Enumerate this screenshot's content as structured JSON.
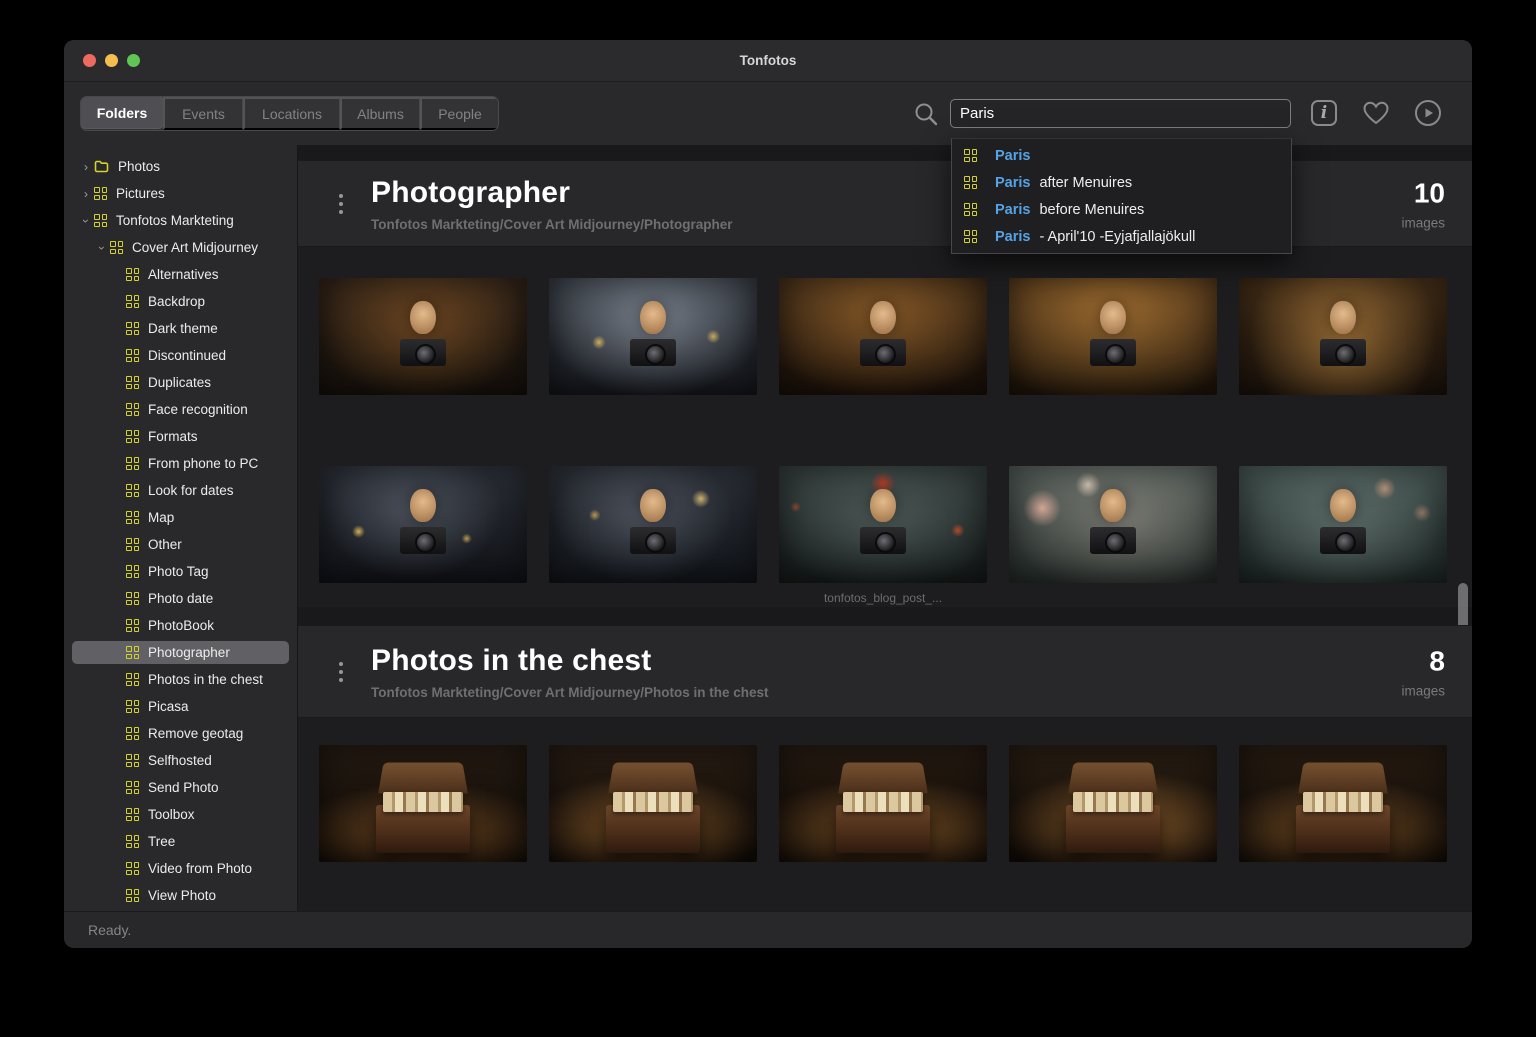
{
  "window": {
    "title": "Tonfotos"
  },
  "toolbar": {
    "tabs": [
      {
        "label": "Folders",
        "active": true
      },
      {
        "label": "Events",
        "active": false
      },
      {
        "label": "Locations",
        "active": false
      },
      {
        "label": "Albums",
        "active": false
      },
      {
        "label": "People",
        "active": false
      }
    ],
    "search": {
      "value": "Paris"
    },
    "icons": [
      "search-icon",
      "info-icon",
      "heart-icon",
      "play-icon"
    ]
  },
  "search_suggestions": [
    {
      "highlight": "Paris",
      "rest": ""
    },
    {
      "highlight": "Paris",
      "rest": " after Menuires"
    },
    {
      "highlight": "Paris",
      "rest": " before Menuires"
    },
    {
      "highlight": "Paris",
      "rest": " - April'10 -Eyjafjallajökull"
    }
  ],
  "sidebar": {
    "items": [
      {
        "label": "Photos",
        "level": 0,
        "icon": "folder",
        "chevron": "collapsed",
        "selected": false
      },
      {
        "label": "Pictures",
        "level": 0,
        "icon": "grid",
        "chevron": "collapsed",
        "selected": false
      },
      {
        "label": "Tonfotos Markteting",
        "level": 0,
        "icon": "grid",
        "chevron": "expanded",
        "selected": false
      },
      {
        "label": "Cover Art Midjourney",
        "level": 1,
        "icon": "grid",
        "chevron": "expanded",
        "selected": false
      },
      {
        "label": "Alternatives",
        "level": 2,
        "icon": "grid",
        "chevron": null,
        "selected": false
      },
      {
        "label": "Backdrop",
        "level": 2,
        "icon": "grid",
        "chevron": null,
        "selected": false
      },
      {
        "label": "Dark theme",
        "level": 2,
        "icon": "grid",
        "chevron": null,
        "selected": false
      },
      {
        "label": "Discontinued",
        "level": 2,
        "icon": "grid",
        "chevron": null,
        "selected": false
      },
      {
        "label": "Duplicates",
        "level": 2,
        "icon": "grid",
        "chevron": null,
        "selected": false
      },
      {
        "label": "Face recognition",
        "level": 2,
        "icon": "grid",
        "chevron": null,
        "selected": false
      },
      {
        "label": "Formats",
        "level": 2,
        "icon": "grid",
        "chevron": null,
        "selected": false
      },
      {
        "label": "From phone to PC",
        "level": 2,
        "icon": "grid",
        "chevron": null,
        "selected": false
      },
      {
        "label": "Look for dates",
        "level": 2,
        "icon": "grid",
        "chevron": null,
        "selected": false
      },
      {
        "label": "Map",
        "level": 2,
        "icon": "grid",
        "chevron": null,
        "selected": false
      },
      {
        "label": "Other",
        "level": 2,
        "icon": "grid",
        "chevron": null,
        "selected": false
      },
      {
        "label": "Photo Tag",
        "level": 2,
        "icon": "grid",
        "chevron": null,
        "selected": false
      },
      {
        "label": "Photo date",
        "level": 2,
        "icon": "grid",
        "chevron": null,
        "selected": false
      },
      {
        "label": "PhotoBook",
        "level": 2,
        "icon": "grid",
        "chevron": null,
        "selected": false
      },
      {
        "label": "Photographer",
        "level": 2,
        "icon": "grid",
        "chevron": null,
        "selected": true
      },
      {
        "label": "Photos in the chest",
        "level": 2,
        "icon": "grid",
        "chevron": null,
        "selected": false
      },
      {
        "label": "Picasa",
        "level": 2,
        "icon": "grid",
        "chevron": null,
        "selected": false
      },
      {
        "label": "Remove geotag",
        "level": 2,
        "icon": "grid",
        "chevron": null,
        "selected": false
      },
      {
        "label": "Selfhosted",
        "level": 2,
        "icon": "grid",
        "chevron": null,
        "selected": false
      },
      {
        "label": "Send Photo",
        "level": 2,
        "icon": "grid",
        "chevron": null,
        "selected": false
      },
      {
        "label": "Toolbox",
        "level": 2,
        "icon": "grid",
        "chevron": null,
        "selected": false
      },
      {
        "label": "Tree",
        "level": 2,
        "icon": "grid",
        "chevron": null,
        "selected": false
      },
      {
        "label": "Video from Photo",
        "level": 2,
        "icon": "grid",
        "chevron": null,
        "selected": false
      },
      {
        "label": "View Photo",
        "level": 2,
        "icon": "grid",
        "chevron": null,
        "selected": false
      }
    ]
  },
  "main": {
    "sections": [
      {
        "title": "Photographer",
        "breadcrumb": "Tonfotos Markteting/Cover Art Midjourney/Photographer",
        "count": "10",
        "count_label": "images",
        "rows": [
          {
            "thumbs": [
              {
                "style": "warm-dark",
                "kind": "portrait",
                "subject": "woman-ornate-headdress-with-camera"
              },
              {
                "style": "steampunk-light",
                "kind": "portrait",
                "subject": "man-top-hat-with-camera"
              },
              {
                "style": "warm-mid",
                "kind": "portrait",
                "subject": "veiled-woman-with-camera"
              },
              {
                "style": "warm-bright",
                "kind": "portrait",
                "subject": "woman-headdress-with-camera"
              },
              {
                "style": "warm-glow",
                "kind": "portrait",
                "subject": "veiled-woman-golden-glow-camera"
              }
            ]
          },
          {
            "thumbs": [
              {
                "style": "steampunk-dark",
                "kind": "portrait",
                "subject": "boy-top-hat-steampunk-camera"
              },
              {
                "style": "steampunk-dark2",
                "kind": "portrait",
                "subject": "boy-top-hat-monocle-camera"
              },
              {
                "style": "underwater",
                "kind": "portrait",
                "subject": "girl-red-beret-underwater-camera",
                "caption": "tonfotos_blog_post_..."
              },
              {
                "style": "pastel",
                "kind": "portrait",
                "subject": "woman-rose-hat-with-camera"
              },
              {
                "style": "teal",
                "kind": "portrait",
                "subject": "woman-flower-hat-teal-camera"
              }
            ]
          }
        ]
      },
      {
        "title": "Photos in the chest",
        "breadcrumb": "Tonfotos Markteting/Cover Art Midjourney/Photos in the chest",
        "count": "8",
        "count_label": "images",
        "rows": [
          {
            "thumbs": [
              {
                "style": "chest-a",
                "kind": "chest",
                "subject": "open-trunk-full-of-photos"
              },
              {
                "style": "chest-b",
                "kind": "chest",
                "subject": "open-chest-with-photographs"
              },
              {
                "style": "chest-c",
                "kind": "chest",
                "subject": "open-chest-spotlight-photos"
              },
              {
                "style": "chest-d",
                "kind": "chest",
                "subject": "chest-with-photo-stacks"
              },
              {
                "style": "chest-e",
                "kind": "chest",
                "subject": "trunk-with-photos-and-camera"
              }
            ]
          }
        ]
      }
    ]
  },
  "statusbar": {
    "text": "Ready."
  },
  "colors": {
    "accent_yellow": "#d4d32a",
    "accent_blue": "#55a3e4",
    "traffic_red": "#ed6a5e",
    "traffic_yellow": "#f5bf4f",
    "traffic_green": "#61c554"
  }
}
